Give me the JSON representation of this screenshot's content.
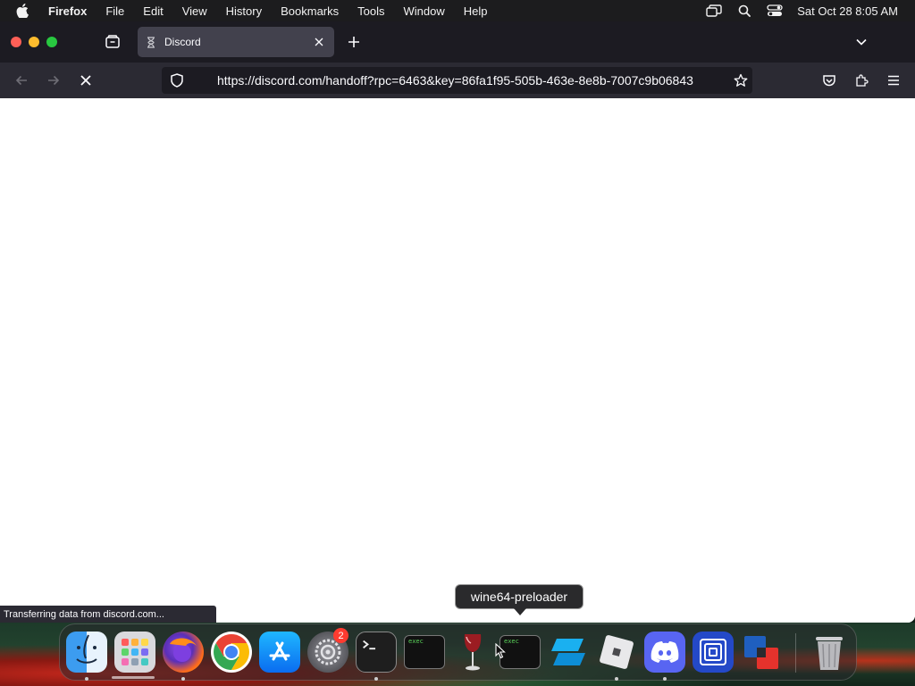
{
  "menubar": {
    "app_name": "Firefox",
    "items": [
      "File",
      "Edit",
      "View",
      "History",
      "Bookmarks",
      "Tools",
      "Window",
      "Help"
    ],
    "clock": "Sat Oct 28  8:05 AM"
  },
  "browser": {
    "tab": {
      "title": "Discord",
      "favicon": "hourglass-icon"
    },
    "url": "https://discord.com/handoff?rpc=6463&key=86fa1f95-505b-463e-8e8b-7007c9b06843",
    "status_text": "Transferring data from discord.com..."
  },
  "dock": {
    "tooltip": "wine64-preloader",
    "apps": [
      {
        "name": "Finder",
        "icon": "finder-icon",
        "running": true
      },
      {
        "name": "Launchpad",
        "icon": "launchpad-icon",
        "running": false
      },
      {
        "name": "Firefox",
        "icon": "firefox-icon",
        "running": true
      },
      {
        "name": "Google Chrome",
        "icon": "chrome-icon",
        "running": false
      },
      {
        "name": "App Store",
        "icon": "app-store-icon",
        "running": false
      },
      {
        "name": "System Settings",
        "icon": "settings-icon",
        "running": false,
        "badge": "2"
      },
      {
        "name": "Terminal",
        "icon": "terminal-icon",
        "running": true
      },
      {
        "name": "exec",
        "icon": "exec-icon",
        "running": false,
        "label": "exec"
      },
      {
        "name": "Wine",
        "icon": "wine-icon",
        "running": false
      },
      {
        "name": "wine64-preloader",
        "icon": "exec-icon",
        "running": false,
        "label": "exec"
      },
      {
        "name": "Roblox Studio",
        "icon": "roblox-studio-icon",
        "running": false
      },
      {
        "name": "Roblox",
        "icon": "roblox-icon",
        "running": true
      },
      {
        "name": "Discord",
        "icon": "discord-icon",
        "running": true
      },
      {
        "name": "Frame App",
        "icon": "frame-app-icon",
        "running": false
      },
      {
        "name": "Parallels",
        "icon": "parallels-icon",
        "running": false
      },
      {
        "name": "Trash",
        "icon": "trash-icon",
        "running": false
      }
    ]
  }
}
